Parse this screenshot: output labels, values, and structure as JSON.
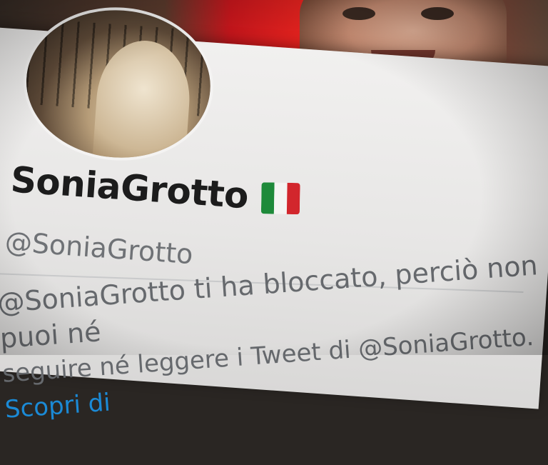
{
  "profile": {
    "display_name": "SoniaGrotto",
    "handle": "@SoniaGrotto",
    "flag_emoji": "italy-flag-icon",
    "flag_colors": [
      "#1e8a3a",
      "#f4f4f2",
      "#d2262c"
    ]
  },
  "blocked_notice": {
    "line1": "@SoniaGrotto ti ha bloccato, perciò non puoi né",
    "line2": "seguire né leggere i Tweet di @SoniaGrotto.",
    "link": "Scopri di"
  },
  "colors": {
    "link": "#1b8ad6",
    "handle_text": "#6f7276",
    "name_text": "#1c1c1c"
  }
}
